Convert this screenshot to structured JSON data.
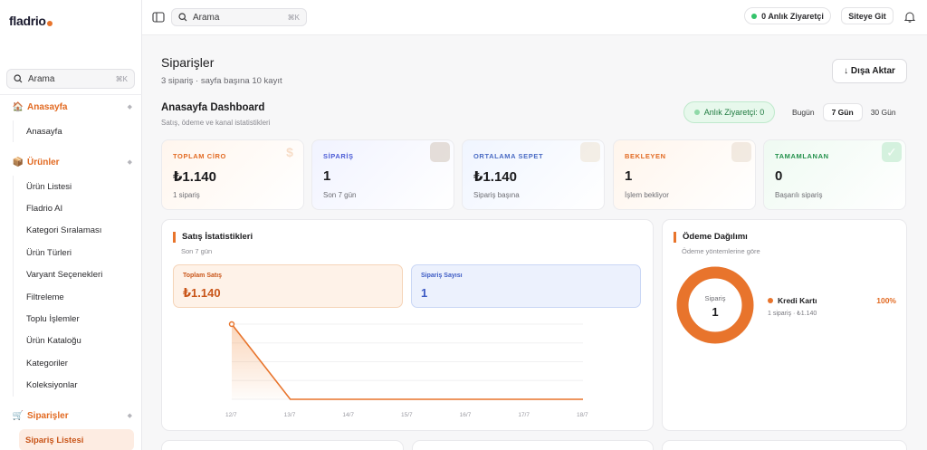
{
  "app": {
    "logo": "fladrio"
  },
  "sidebar": {
    "search": {
      "label": "Arama",
      "shortcut": "⌘K"
    },
    "sections": [
      {
        "label": "Anasayfa",
        "icon": "home-icon",
        "items": [
          "Anasayfa"
        ]
      },
      {
        "label": "Ürünler",
        "icon": "box-icon",
        "items": [
          "Ürün Listesi",
          "Fladrio AI",
          "Kategori Sıralaması",
          "Ürün Türleri",
          "Varyant Seçenekleri",
          "Filtreleme",
          "Toplu İşlemler",
          "Ürün Kataloğu",
          "Kategoriler",
          "Koleksiyonlar"
        ]
      },
      {
        "label": "Siparişler",
        "icon": "cart-icon",
        "items": [
          "Sipariş Listesi"
        ]
      }
    ]
  },
  "topbar": {
    "search": {
      "label": "Arama",
      "shortcut": "⌘K"
    },
    "live_visitors": "0 Anlık Ziyaretçi",
    "site_button": "Siteye Git"
  },
  "page": {
    "title": "Siparişler",
    "subtitle": "3 sipariş · sayfa başına 10 kayıt",
    "export_label": "↓ Dışa Aktar"
  },
  "dashboard": {
    "title": "Anasayfa Dashboard",
    "subtitle": "Satış, ödeme ve kanal istatistikleri",
    "live_pill": "Anlık Ziyaretçi: 0",
    "ranges": [
      "Bugün",
      "7 Gün",
      "30 Gün"
    ],
    "active_range": "7 Gün",
    "colors": {
      "accent": "#e8742c",
      "green": "#34c36b"
    }
  },
  "kpis": [
    {
      "label": "TOPLAM CİRO",
      "value": "₺1.140",
      "hint": "1 sipariş",
      "icon": "money-icon"
    },
    {
      "label": "SİPARİŞ",
      "value": "1",
      "hint": "Son 7 gün",
      "icon": "package-icon"
    },
    {
      "label": "ORTALAMA SEPET",
      "value": "₺1.140",
      "hint": "Sipariş başına",
      "icon": "basket-icon"
    },
    {
      "label": "BEKLEYEN",
      "value": "1",
      "hint": "İşlem bekliyor",
      "icon": "hourglass-icon"
    },
    {
      "label": "TAMAMLANAN",
      "value": "0",
      "hint": "Başarılı sipariş",
      "icon": "check-icon"
    }
  ],
  "sales": {
    "title": "Satış İstatistikleri",
    "subtitle": "Son 7 gün",
    "total_label": "Toplam Satış",
    "total_value": "₺1.140",
    "count_label": "Sipariş Sayısı",
    "count_value": "1"
  },
  "payment": {
    "title": "Ödeme Dağılımı",
    "subtitle": "Ödeme yöntemlerine göre",
    "center_label": "Sipariş",
    "center_value": "1",
    "legend": [
      {
        "name": "Kredi Kartı",
        "pct": "100%",
        "detail": "1 sipariş · ₺1.140"
      }
    ]
  },
  "chart_data": {
    "type": "area",
    "x": [
      "12/7",
      "13/7",
      "14/7",
      "15/7",
      "16/7",
      "17/7",
      "18/7"
    ],
    "values": [
      1140,
      0,
      0,
      0,
      0,
      0,
      0
    ],
    "ylim": [
      0,
      1140
    ],
    "grid": true
  }
}
